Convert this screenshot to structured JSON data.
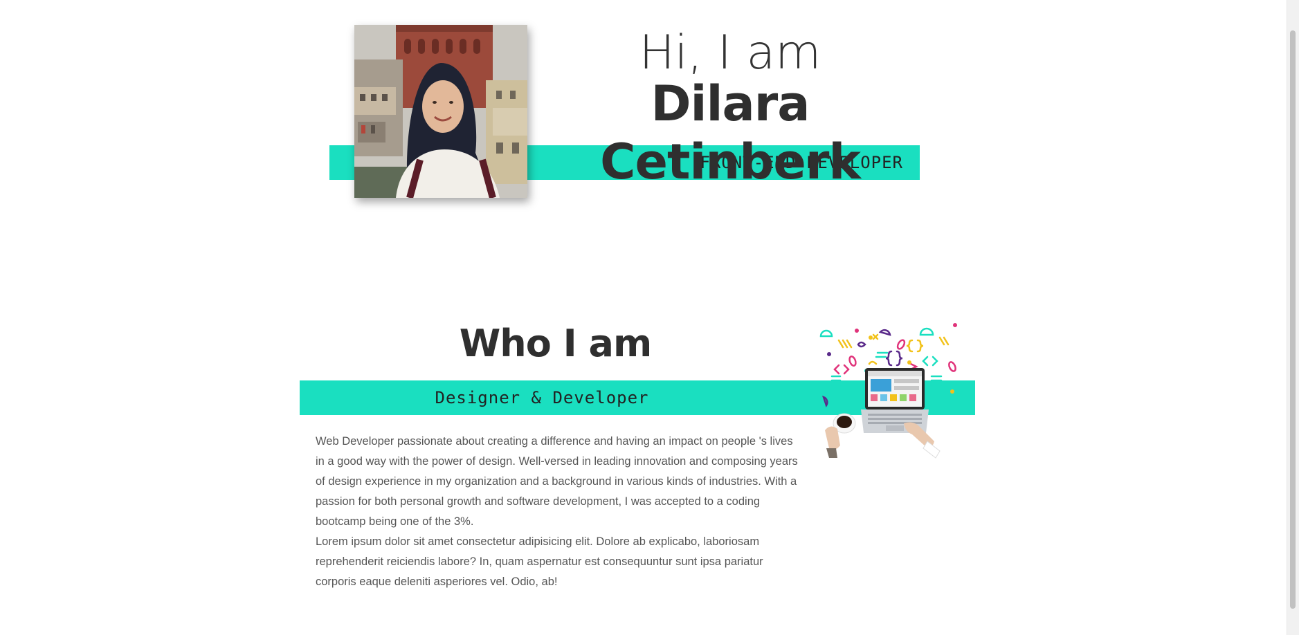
{
  "hero": {
    "greeting": "Hi, I am",
    "name": "Dilara Cetinberk",
    "role": "FRONT-END DEVELOPER",
    "accent_color": "#1adfc0"
  },
  "about": {
    "title": "Who I am",
    "subtitle": "Designer & Developer",
    "paragraphs": [
      "Web Developer passionate about creating a difference and having an impact on people 's lives in a good way with the power of design. Well-versed in leading innovation and composing years of design experience in my organization and a background in various kinds of industries. With a passion for both personal growth and software development, I was accepted to a coding bootcamp being one of the 3%.",
      "Lorem ipsum dolor sit amet consectetur adipisicing elit. Dolore ab explicabo, laboriosam reprehenderit reiciendis labore? In, quam aspernatur est consequuntur sunt ipsa pariatur corporis eaque deleniti asperiores vel. Odio, ab!"
    ]
  },
  "icons": {
    "portrait": "profile-photo",
    "illustration": "laptop-coffee-illustration"
  }
}
